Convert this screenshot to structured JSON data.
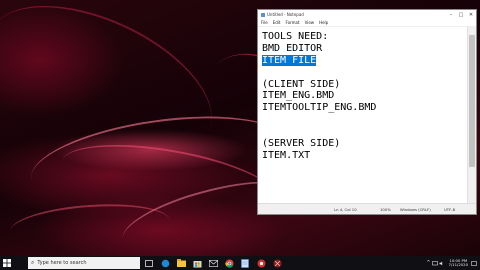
{
  "notepad": {
    "title": "Untitled - Notepad",
    "menu": [
      "File",
      "Edit",
      "Format",
      "View",
      "Help"
    ],
    "lines": [
      "TOOLS NEED:",
      "BMD EDITOR",
      "ITEM FILE",
      "",
      "(CLIENT SIDE)",
      "ITEM_ENG.BMD",
      "ITEMTOOLTIP_ENG.BMD",
      "",
      "",
      "(SERVER SIDE)",
      "ITEM.TXT"
    ],
    "selected_line": 2,
    "status": {
      "position": "Ln 4, Col 10",
      "zoom": "100%",
      "line_ending": "Windows (CRLF)",
      "encoding": "UTF-8"
    }
  },
  "taskbar": {
    "search_placeholder": "Type here to search",
    "clock_time": "10:00 PM",
    "clock_date": "7/11/2020"
  },
  "colors": {
    "selection": "#0078d7",
    "taskbar": "#101014"
  }
}
